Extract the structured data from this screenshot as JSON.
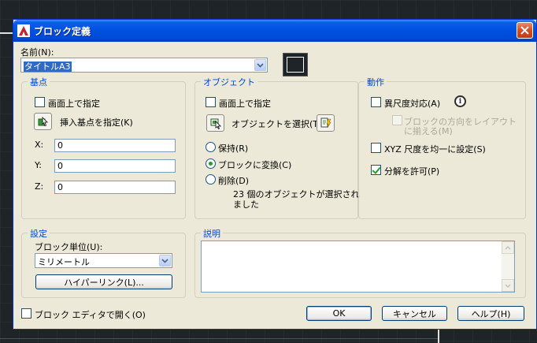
{
  "window": {
    "title": "ブロック定義"
  },
  "name": {
    "label": "名前(N):",
    "value": "タイトルA3"
  },
  "basepoint": {
    "title": "基点",
    "specify_on_screen": "画面上で指定",
    "pick_label": "挿入基点を指定(K)",
    "x_label": "X:",
    "y_label": "Y:",
    "z_label": "Z:",
    "x": "0",
    "y": "0",
    "z": "0"
  },
  "objects": {
    "title": "オブジェクト",
    "specify_on_screen": "画面上で指定",
    "select_label": "オブジェクトを選択(T)",
    "retain": "保持(R)",
    "convert": "ブロックに変換(C)",
    "delete": "削除(D)",
    "status_line1": "23 個のオブジェクトが選択され",
    "status_line2": "ました",
    "selected_option": "convert"
  },
  "behavior": {
    "title": "動作",
    "annotative": "異尺度対応(A)",
    "match_orientation_line1": "ブロックの方向をレイアウト",
    "match_orientation_line2": "に揃える(M)",
    "scale_uniformly": "XYZ 尺度を均一に設定(S)",
    "allow_exploding": "分解を許可(P)"
  },
  "settings": {
    "title": "設定",
    "unit_label": "ブロック単位(U):",
    "unit_value": "ミリメートル",
    "hyperlink_button": "ハイパーリンク(L)..."
  },
  "description": {
    "title": "説明"
  },
  "footer": {
    "open_in_editor": "ブロック エディタで開く(O)",
    "ok": "OK",
    "cancel": "キャンセル",
    "help": "ヘルプ(H)"
  },
  "colors": {
    "titlebar": "#0052e0",
    "group_title": "#0046d5",
    "dialog_bg": "#ece9d8",
    "canvas_bg": "#1e2428"
  }
}
